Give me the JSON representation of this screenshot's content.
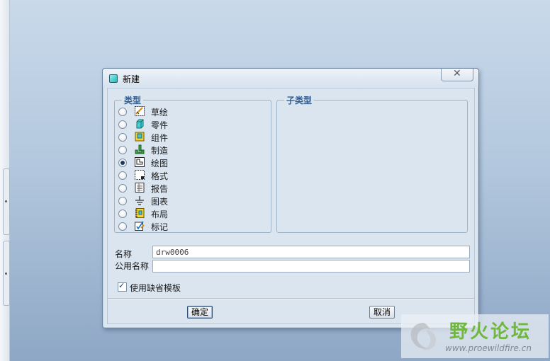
{
  "dialog": {
    "title": "新建",
    "close_label": "✕",
    "type_group_label": "类型",
    "subtype_group_label": "子类型",
    "types": [
      {
        "label": "草绘",
        "icon": "sketch-icon",
        "checked": false
      },
      {
        "label": "零件",
        "icon": "part-icon",
        "checked": false
      },
      {
        "label": "组件",
        "icon": "assembly-icon",
        "checked": false
      },
      {
        "label": "制造",
        "icon": "manufacturing-icon",
        "checked": false
      },
      {
        "label": "绘图",
        "icon": "drawing-icon",
        "checked": true
      },
      {
        "label": "格式",
        "icon": "format-icon",
        "checked": false
      },
      {
        "label": "报告",
        "icon": "report-icon",
        "checked": false
      },
      {
        "label": "图表",
        "icon": "diagram-icon",
        "checked": false
      },
      {
        "label": "布局",
        "icon": "layout-icon",
        "checked": false
      },
      {
        "label": "标记",
        "icon": "markup-icon",
        "checked": false
      }
    ],
    "name_label": "名称",
    "name_value": "drw0006",
    "common_name_label": "公用名称",
    "common_name_value": "",
    "use_default_template_label": "使用缺省模板",
    "use_default_template_checked": true,
    "ok_label": "确定",
    "cancel_label": "取消"
  },
  "watermark": {
    "title": "野火论坛",
    "url": "www.proewildfire.cn"
  },
  "colors": {
    "legend": "#2f5d91",
    "dialog_bg": "#dbe6f1",
    "desktop_top": "#c9d9ea",
    "desktop_bottom": "#8ea7c5",
    "watermark_green": "#6fb73f"
  }
}
